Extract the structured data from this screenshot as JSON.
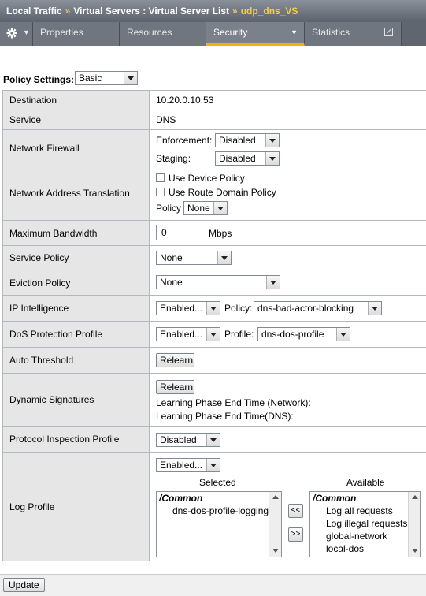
{
  "breadcrumb": {
    "items": [
      "Local Traffic",
      "Virtual Servers : Virtual Server List",
      "udp_dns_VS"
    ],
    "separator": "»"
  },
  "tabs": {
    "gear_icon": "gear-icon",
    "items": [
      {
        "label": "Properties"
      },
      {
        "label": "Resources"
      },
      {
        "label": "Security",
        "active": true
      },
      {
        "label": "Statistics"
      }
    ]
  },
  "policy_settings": {
    "label": "Policy Settings:",
    "value": "Basic"
  },
  "rows": {
    "destination": {
      "label": "Destination",
      "value": "10.20.0.10:53"
    },
    "service": {
      "label": "Service",
      "value": "DNS"
    },
    "network_firewall": {
      "label": "Network Firewall",
      "enforcement_label": "Enforcement:",
      "enforcement_value": "Disabled",
      "staging_label": "Staging:",
      "staging_value": "Disabled"
    },
    "nat": {
      "label": "Network Address Translation",
      "use_device_policy": "Use Device Policy",
      "use_route_domain_policy": "Use Route Domain Policy",
      "policy_label": "Policy",
      "policy_value": "None"
    },
    "max_bandwidth": {
      "label": "Maximum Bandwidth",
      "value": "0",
      "unit": "Mbps"
    },
    "service_policy": {
      "label": "Service Policy",
      "value": "None"
    },
    "eviction_policy": {
      "label": "Eviction Policy",
      "value": "None"
    },
    "ip_intelligence": {
      "label": "IP Intelligence",
      "value": "Enabled...",
      "policy_label": "Policy:",
      "policy_value": "dns-bad-actor-blocking"
    },
    "dos_profile": {
      "label": "DoS Protection Profile",
      "value": "Enabled...",
      "profile_label": "Profile:",
      "profile_value": "dns-dos-profile"
    },
    "auto_threshold": {
      "label": "Auto Threshold",
      "button": "Relearn"
    },
    "dynamic_signatures": {
      "label": "Dynamic Signatures",
      "button": "Relearn",
      "line1": "Learning Phase End Time (Network):",
      "line2": "Learning Phase End Time(DNS):"
    },
    "protocol_inspection": {
      "label": "Protocol Inspection Profile",
      "value": "Disabled"
    },
    "log_profile": {
      "label": "Log Profile",
      "value": "Enabled...",
      "selected_header": "Selected",
      "available_header": "Available",
      "selected_group": "/Common",
      "selected_items": [
        "dns-dos-profile-logging"
      ],
      "available_group": "/Common",
      "available_items": [
        "Log all requests",
        "Log illegal requests",
        "global-network",
        "local-dos"
      ],
      "move_left": "<<",
      "move_right": ">>"
    }
  },
  "update_button": "Update"
}
